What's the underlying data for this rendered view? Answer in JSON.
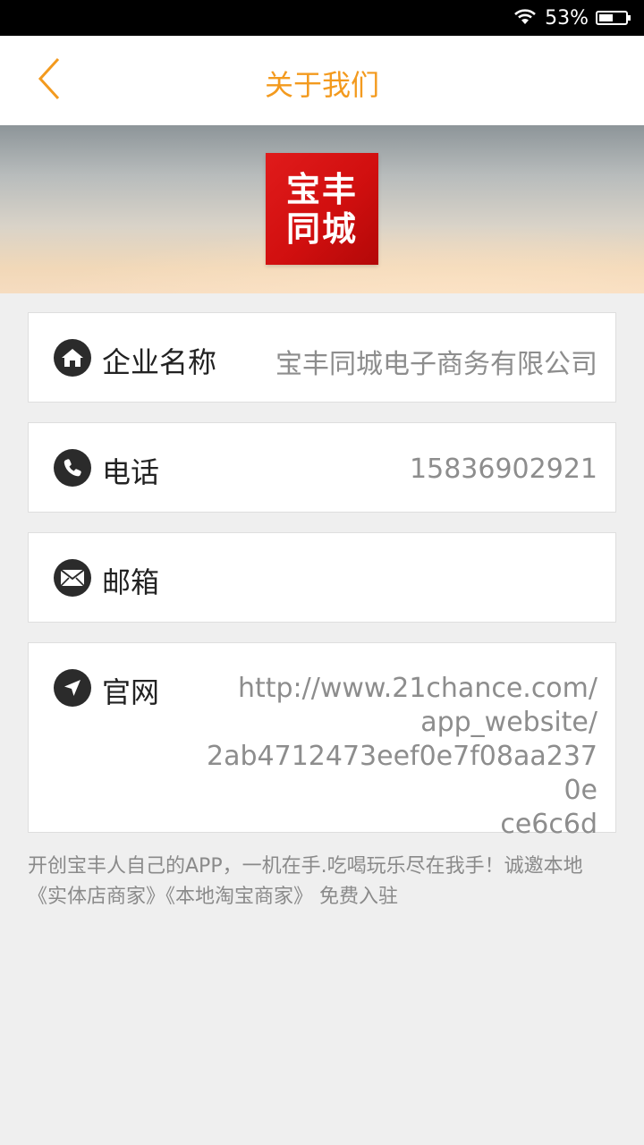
{
  "status_bar": {
    "battery_text": "53%",
    "battery_level": 0.53,
    "wifi_icon": "wifi-icon"
  },
  "header": {
    "title": "关于我们",
    "back_icon": "chevron-left-icon",
    "accent_color": "#f39a1e"
  },
  "banner": {
    "logo_line1": "宝丰",
    "logo_line2": "同城",
    "logo_color": "#d81414"
  },
  "company": {
    "icon": "home-icon",
    "label": "企业名称",
    "value": "宝丰同城电子商务有限公司"
  },
  "phone": {
    "icon": "phone-icon",
    "label": "电话",
    "value": "15836902921"
  },
  "email": {
    "icon": "mail-icon",
    "label": "邮箱",
    "value": ""
  },
  "website": {
    "icon": "location-arrow-icon",
    "label": "官网",
    "value": "http://www.21chance.com/\napp_website/\n2ab4712473eef0e7f08aa2370e\nce6c6d"
  },
  "footer": {
    "text": "开创宝丰人自己的APP，一机在手.吃喝玩乐尽在我手！诚邀本地《实体店商家》《本地淘宝商家》 免费入驻"
  }
}
